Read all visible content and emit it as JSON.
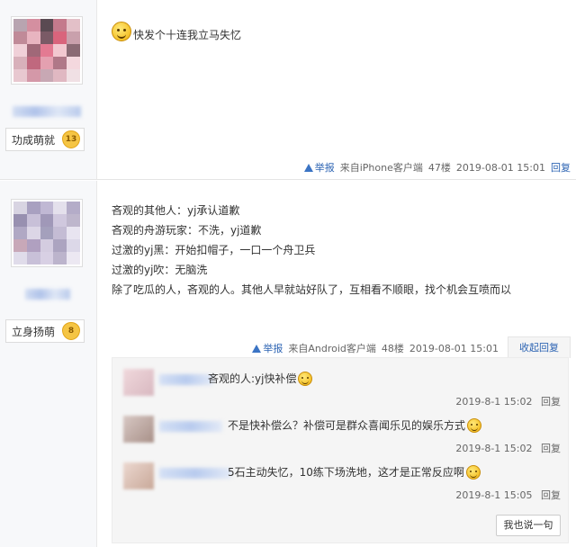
{
  "post1": {
    "badge_label": "功成萌就",
    "badge_level": "13",
    "content": "快发个十连我立马失忆",
    "report_label": "举报",
    "source": "来自iPhone客户端",
    "floor": "47楼",
    "time": "2019-08-01 15:01",
    "reply_label": "回复"
  },
  "post2": {
    "badge_label": "立身扬萌",
    "badge_level": "8",
    "lines": [
      "吝观的其他人：yj承认道歉",
      "吝观的舟游玩家：不洗，yj道歉",
      "过激的yj黑：开始扣帽子，一口一个舟卫兵",
      "过激的yj吹：无脑洗",
      "除了吃瓜的人，吝观的人。其他人早就站好队了，互相看不顺眼，找个机会互喷而以"
    ],
    "report_label": "举报",
    "source": "来自Android客户端",
    "floor": "48楼",
    "time": "2019-08-01 15:01",
    "collapse_label": "收起回复",
    "replies": [
      {
        "text": "吝观的人:yj快补偿",
        "time": "2019-8-1 15:02",
        "reply_label": "回复"
      },
      {
        "text": "不是快补偿么？补偿可是群众喜闻乐见的娱乐方式",
        "time": "2019-8-1 15:02",
        "reply_label": "回复"
      },
      {
        "text": "5石主动失忆，10练下场洗地，这才是正常反应啊",
        "time": "2019-8-1 15:05",
        "reply_label": "回复"
      }
    ],
    "say_button": "我也说一句"
  },
  "colors": {
    "link": "#2d64b3",
    "sidebar": "#f7f8fa",
    "lzl_bg": "#f5f5f5"
  },
  "icons": [
    "avatar",
    "level-badge-icon",
    "smiley-emoticon-icon",
    "report-warning-icon"
  ]
}
